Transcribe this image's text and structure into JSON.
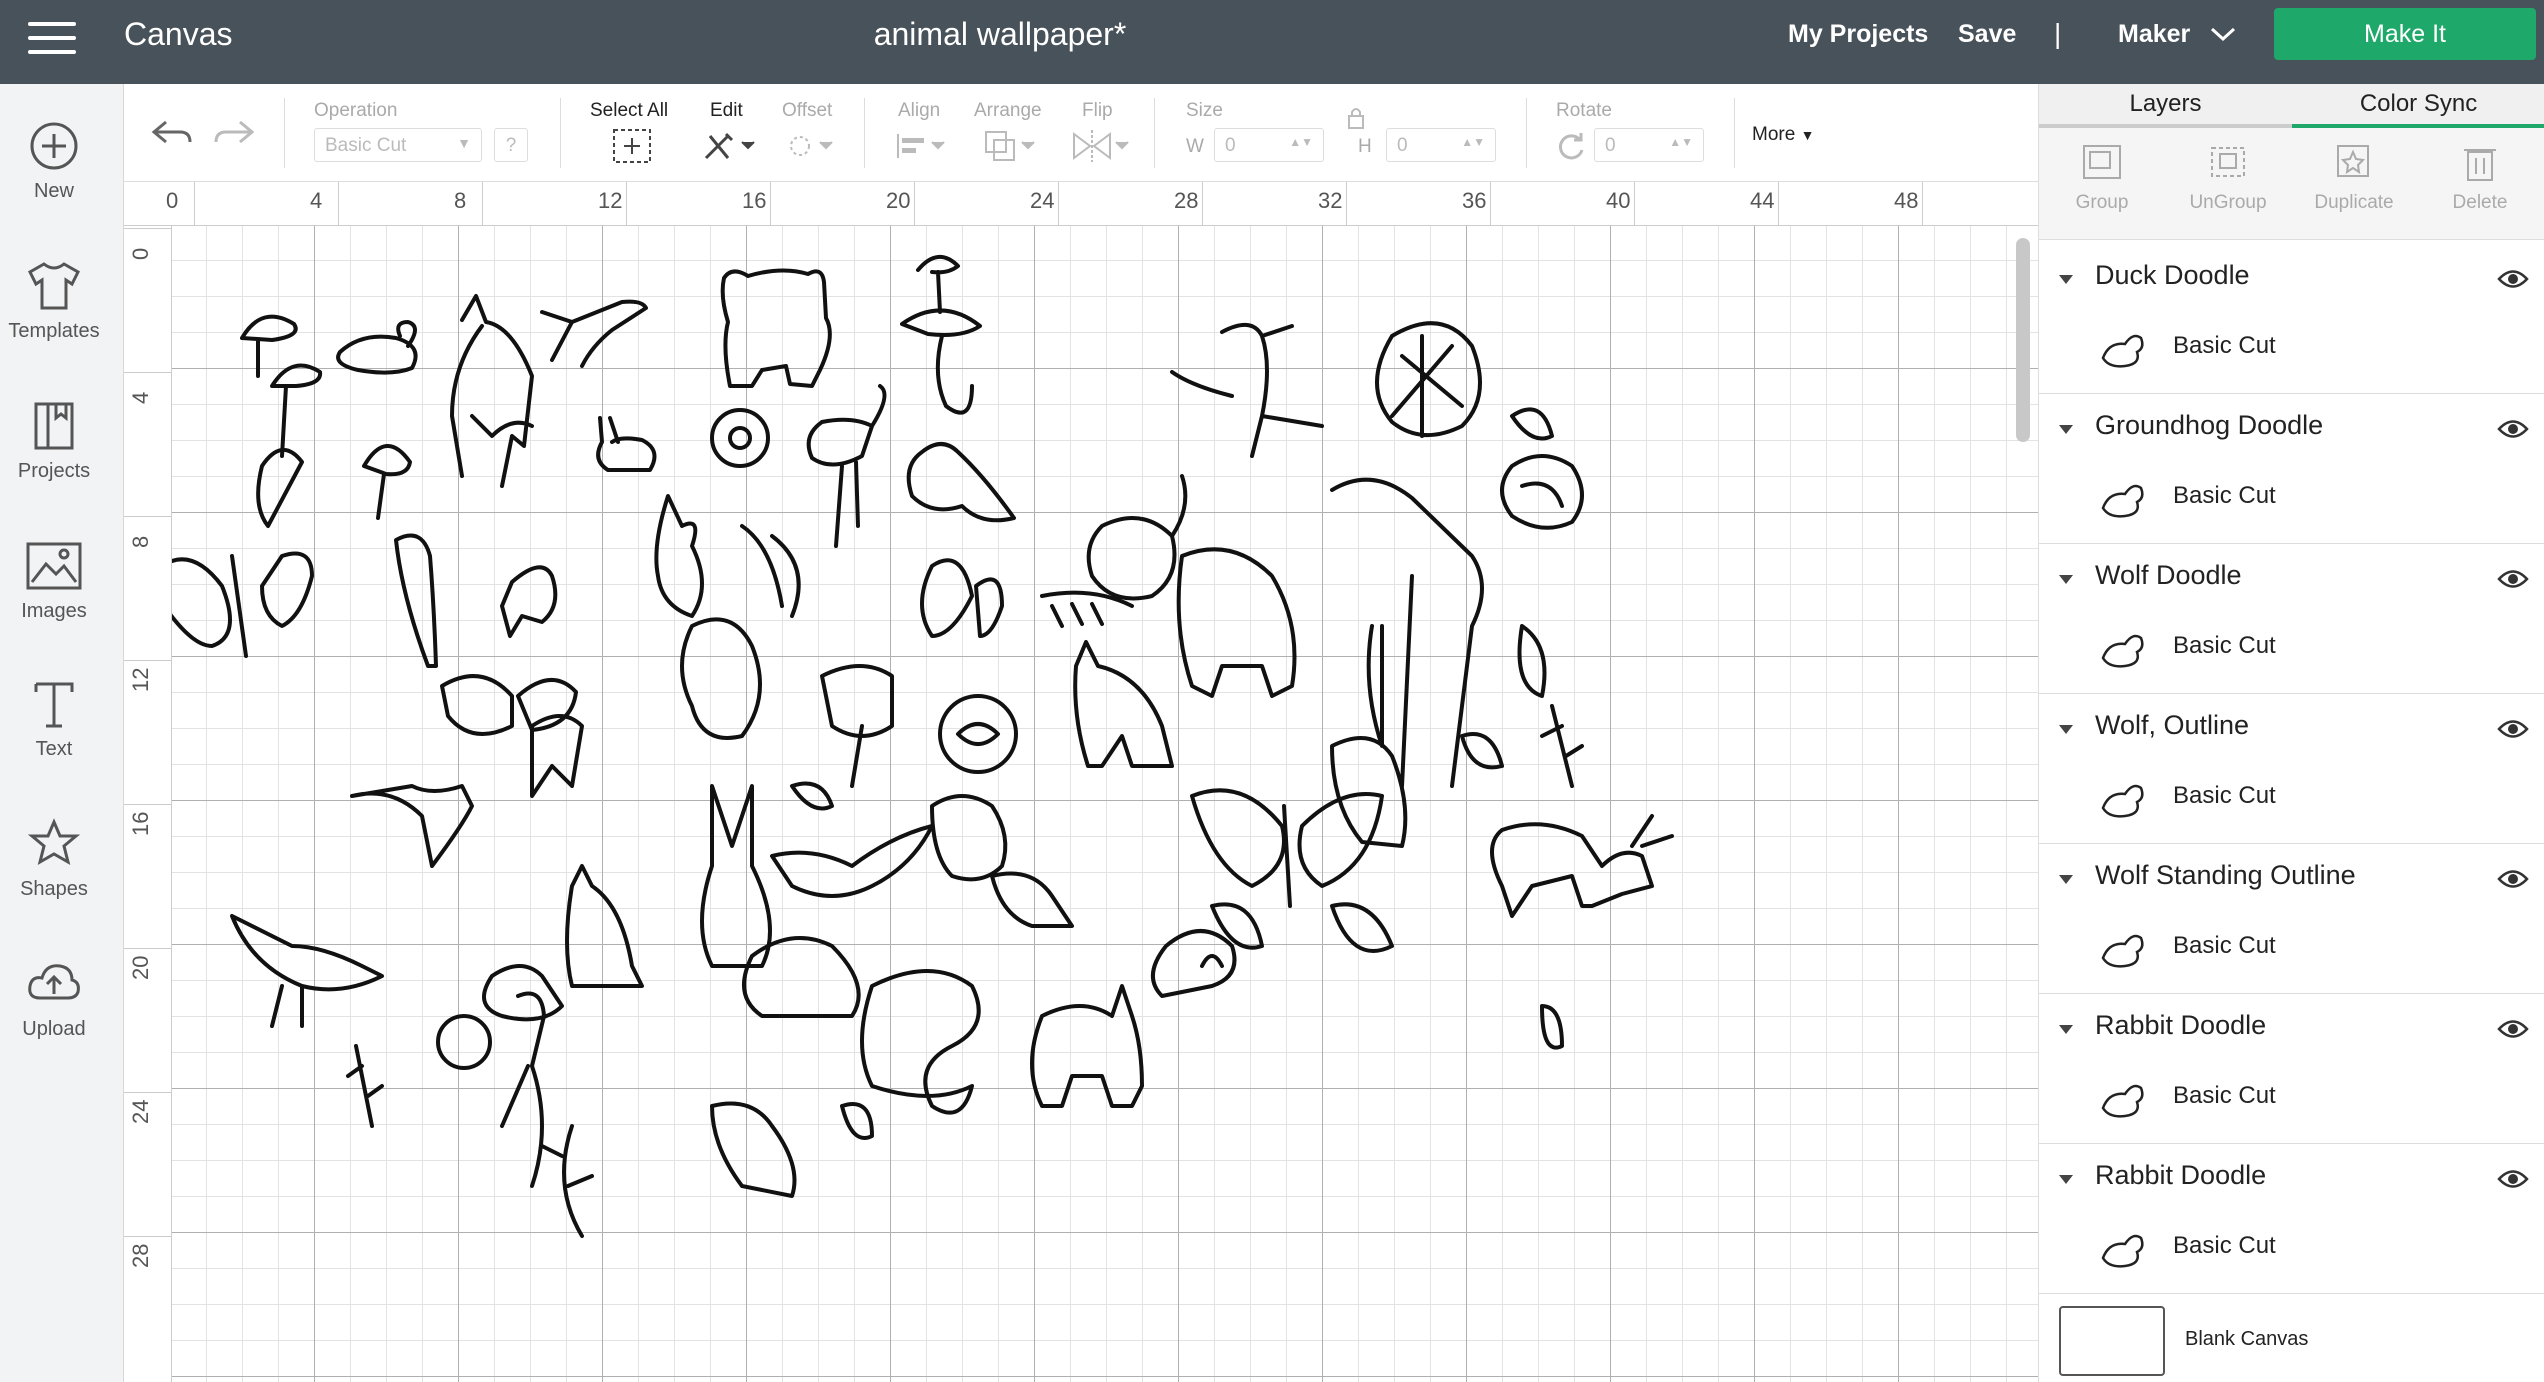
{
  "header": {
    "app_title": "Canvas",
    "document_title": "animal wallpaper*",
    "my_projects": "My Projects",
    "save": "Save",
    "divider": "|",
    "machine": "Maker",
    "make_it": "Make It"
  },
  "sidebar": {
    "items": [
      {
        "label": "New",
        "icon": "plus-circle-icon"
      },
      {
        "label": "Templates",
        "icon": "tshirt-icon"
      },
      {
        "label": "Projects",
        "icon": "projects-icon"
      },
      {
        "label": "Images",
        "icon": "image-icon"
      },
      {
        "label": "Text",
        "icon": "text-icon"
      },
      {
        "label": "Shapes",
        "icon": "shapes-icon"
      },
      {
        "label": "Upload",
        "icon": "cloud-upload-icon"
      }
    ]
  },
  "toolbar": {
    "operation_label": "Operation",
    "operation_value": "Basic Cut",
    "help": "?",
    "select_all": "Select All",
    "edit": "Edit",
    "offset": "Offset",
    "align": "Align",
    "arrange": "Arrange",
    "flip": "Flip",
    "size": "Size",
    "w_label": "W",
    "w_value": "0",
    "h_label": "H",
    "h_value": "0",
    "rotate": "Rotate",
    "rotate_value": "0",
    "more": "More"
  },
  "ruler": {
    "top_ticks": [
      "0",
      "4",
      "8",
      "12",
      "16",
      "20",
      "24",
      "28",
      "32",
      "36",
      "40",
      "44",
      "48"
    ],
    "left_ticks": [
      "0",
      "4",
      "8",
      "12",
      "16",
      "20",
      "24",
      "28"
    ]
  },
  "panel": {
    "tabs": [
      "Layers",
      "Color Sync"
    ],
    "tools": [
      "Group",
      "UnGroup",
      "Duplicate",
      "Delete"
    ],
    "layers": [
      {
        "name": "Duck Doodle",
        "operation": "Basic Cut"
      },
      {
        "name": "Groundhog Doodle",
        "operation": "Basic Cut"
      },
      {
        "name": "Wolf Doodle",
        "operation": "Basic Cut"
      },
      {
        "name": "Wolf, Outline",
        "operation": "Basic Cut"
      },
      {
        "name": "Wolf Standing Outline",
        "operation": "Basic Cut"
      },
      {
        "name": "Rabbit Doodle",
        "operation": "Basic Cut"
      },
      {
        "name": "Rabbit Doodle",
        "operation": "Basic Cut"
      }
    ],
    "blank_canvas": "Blank Canvas"
  },
  "colors": {
    "header_bg": "#48525a",
    "make_it": "#1ea86a",
    "sidebar_bg": "#f2f3f4"
  }
}
